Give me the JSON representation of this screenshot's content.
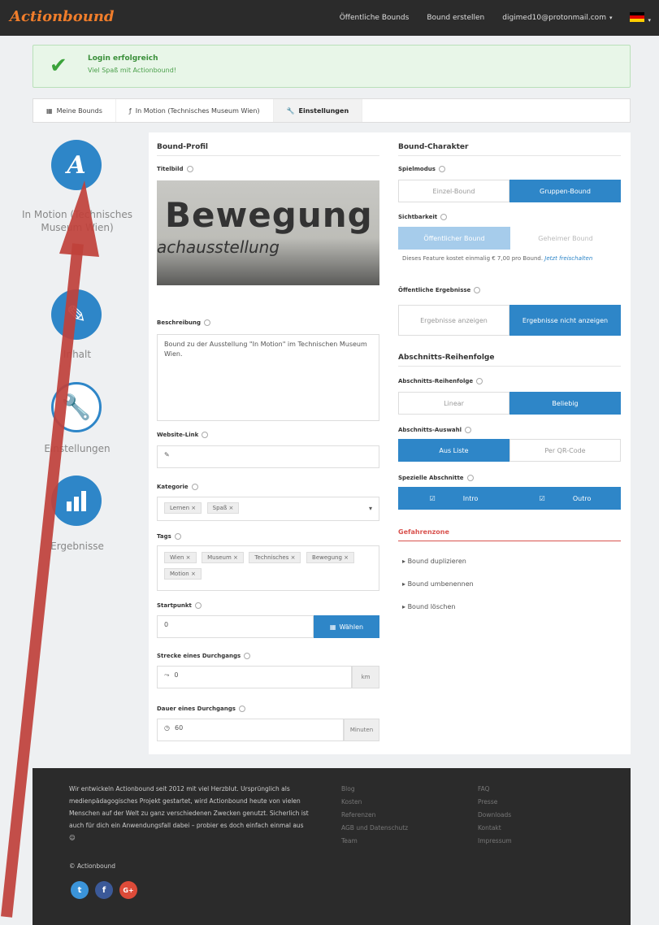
{
  "topbar": {
    "logo": "Actionbound",
    "nav": [
      "Öffentliche Bounds",
      "Bound erstellen"
    ],
    "user": "digimed10@protonmail.com",
    "caret": "▾",
    "flag_caret": "▾"
  },
  "alert": {
    "title": "Login erfolgreich",
    "text": "Viel Spaß mit Actionbound!",
    "icon": "check-icon"
  },
  "breadcrumb": [
    {
      "label": "Meine Bounds",
      "icon": "grid-icon"
    },
    {
      "label": "In Motion (Technisches Museum Wien)",
      "icon": "actionbound-icon"
    },
    {
      "label": "Einstellungen",
      "icon": "wrench-icon"
    }
  ],
  "sidebar": [
    {
      "label": "In Motion (Technisches Museum Wien)",
      "glyph": "A"
    },
    {
      "label": "Inhalt",
      "glyph": "✎"
    },
    {
      "label": "Einstellungen",
      "glyph": "🔧"
    },
    {
      "label": "Ergebnisse",
      "glyph": "▮"
    }
  ],
  "profile": {
    "heading": "Bound-Profil",
    "title_image_label": "Titelbild",
    "image_text_main": "Bewegung",
    "image_text_sub": "achausstellung",
    "desc_label": "Beschreibung",
    "desc_value": "Bound zu der Ausstellung \"In Motion\" im Technischen Museum Wien.",
    "website_label": "Website-Link",
    "category_label": "Kategorie",
    "categories": [
      "Lernen ×",
      "Spaß ×"
    ],
    "tags_label": "Tags",
    "tags": [
      "Wien ×",
      "Museum ×",
      "Technisches ×",
      "Bewegung ×",
      "Motion ×"
    ],
    "start_label": "Startpunkt",
    "start_value": "0",
    "start_button": "Wählen",
    "distance_label": "Strecke eines Durchgangs",
    "distance_value": "0",
    "distance_unit": "km",
    "duration_label": "Dauer eines Durchgangs",
    "duration_value": "60",
    "duration_unit": "Minuten"
  },
  "character": {
    "heading": "Bound-Charakter",
    "mode_label": "Spielmodus",
    "mode_options": [
      "Einzel-Bound",
      "Gruppen-Bound"
    ],
    "visibility_label": "Sichtbarkeit",
    "visibility_options": [
      "Öffentlicher Bound",
      "Geheimer Bound"
    ],
    "visibility_note": "Dieses Feature kostet einmalig € 7,00 pro Bound.",
    "visibility_link": "Jetzt freischalten",
    "results_label": "Öffentliche Ergebnisse",
    "results_options": [
      "Ergebnisse anzeigen",
      "Ergebnisse nicht anzeigen"
    ],
    "order_heading": "Abschnitts-Reihenfolge",
    "order_label": "Abschnitts-Reihenfolge",
    "order_options": [
      "Linear",
      "Beliebig"
    ],
    "select_label": "Abschnitts-Auswahl",
    "select_options": [
      "Aus Liste",
      "Per QR-Code"
    ],
    "special_label": "Spezielle Abschnitte",
    "special_options": [
      "Intro",
      "Outro"
    ],
    "danger_heading": "Gefahrenzone",
    "danger_items": [
      "Bound duplizieren",
      "Bound umbenennen",
      "Bound löschen"
    ]
  },
  "footer": {
    "about": "Wir entwickeln Actionbound seit 2012 mit viel Herzblut. Ursprünglich als medienpädagogisches Projekt gestartet, wird Actionbound heute von vielen Menschen auf der Welt zu ganz verschiedenen Zwecken genutzt. Sicherlich ist auch für dich ein Anwendungsfall dabei – probier es doch einfach einmal aus ☺",
    "copyright": "© Actionbound",
    "col1": [
      "Blog",
      "Kosten",
      "Referenzen",
      "AGB und Datenschutz",
      "Team"
    ],
    "col2": [
      "FAQ",
      "Presse",
      "Downloads",
      "Kontakt",
      "Impressum"
    ],
    "social": [
      "t",
      "f",
      "G+"
    ]
  },
  "colors": {
    "accent": "#2e86c8",
    "logo": "#f07d2b",
    "arrow": "#c0413b"
  }
}
